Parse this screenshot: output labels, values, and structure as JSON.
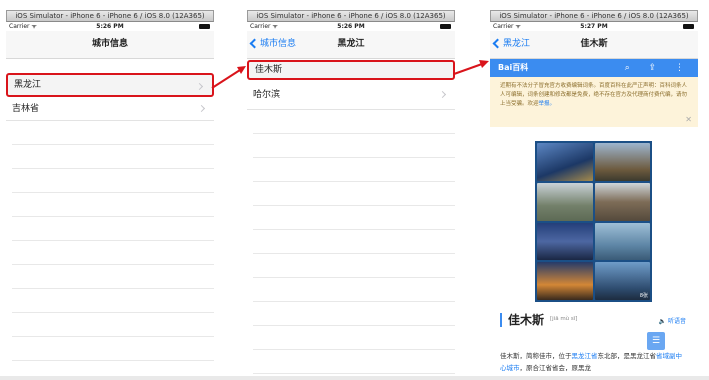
{
  "screens": [
    {
      "window_title": "iOS Simulator - iPhone 6 - iPhone 6 / iOS 8.0 (12A365)",
      "carrier": "Carrier ᯤ",
      "time": "5:26 PM",
      "nav_title": "城市信息",
      "rows": [
        {
          "label": "黑龙江",
          "selected": true
        },
        {
          "label": "吉林省",
          "selected": false
        }
      ]
    },
    {
      "window_title": "iOS Simulator - iPhone 6 - iPhone 6 / iOS 8.0 (12A365)",
      "carrier": "Carrier ᯤ",
      "time": "5:26 PM",
      "back_label": "城市信息",
      "nav_title": "黑龙江",
      "rows": [
        {
          "label": "佳木斯",
          "selected": true
        },
        {
          "label": "哈尔滨",
          "selected": false
        }
      ]
    },
    {
      "window_title": "iOS Simulator - iPhone 6 - iPhone 6 / iOS 8.0 (12A365)",
      "carrier": "Carrier ᯤ",
      "time": "5:27 PM",
      "back_label": "黑龙江",
      "nav_title": "佳木斯",
      "baidu": {
        "logo": "Bai百科",
        "icons": "⌕ ⇪ ⋮",
        "notice": "近期有不法分子冒充官方收费编辑词条。百度百科在此严正声明：百科词条人人可编辑，词条创建和修改都是免费，绝不存在官方及代理商付费代编，请勿上当受骗。欢迎",
        "notice_link": "举报。",
        "gallery_count": "8张",
        "entry_title": "佳木斯",
        "entry_pinyin": "[jiā mù sī]",
        "audio_label": "🔈 听语音",
        "para_1": "佳木斯，简称佳市，位于",
        "para_link_1": "黑龙江省",
        "para_2": "东北部，是黑龙江省",
        "para_link_2": "省域副中心城市",
        "para_3": "，原合江省省会，原黑龙"
      }
    }
  ],
  "colors": {
    "selection_border": "#d9141b",
    "ios_blue": "#1a7cf2",
    "baidu_blue": "#3b8cf0"
  }
}
